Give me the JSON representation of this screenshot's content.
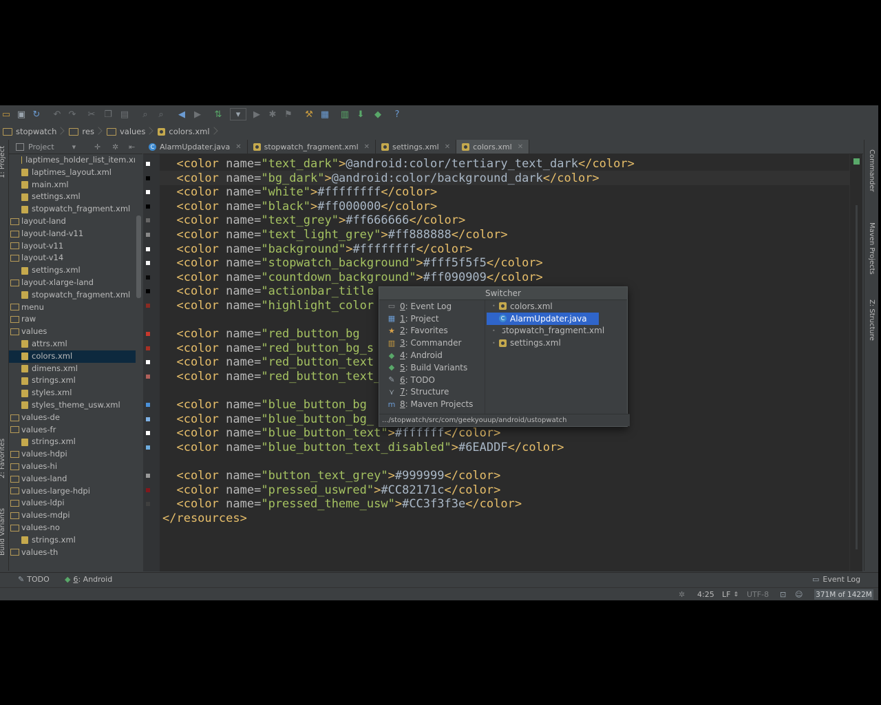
{
  "breadcrumb": [
    "stopwatch",
    "res",
    "values",
    "colors.xml"
  ],
  "project_panel": {
    "title": "Project",
    "tree": [
      {
        "label": "laptimes_holder_list_item.xı",
        "kind": "file",
        "indent": 2
      },
      {
        "label": "laptimes_layout.xml",
        "kind": "file",
        "indent": 2
      },
      {
        "label": "main.xml",
        "kind": "file",
        "indent": 2
      },
      {
        "label": "settings.xml",
        "kind": "file",
        "indent": 2
      },
      {
        "label": "stopwatch_fragment.xml",
        "kind": "file",
        "indent": 2
      },
      {
        "label": "layout-land",
        "kind": "folder",
        "indent": 1
      },
      {
        "label": "layout-land-v11",
        "kind": "folder",
        "indent": 1
      },
      {
        "label": "layout-v11",
        "kind": "folder",
        "indent": 1
      },
      {
        "label": "layout-v14",
        "kind": "folder",
        "indent": 1
      },
      {
        "label": "settings.xml",
        "kind": "file",
        "indent": 2
      },
      {
        "label": "layout-xlarge-land",
        "kind": "folder",
        "indent": 1
      },
      {
        "label": "stopwatch_fragment.xml",
        "kind": "file",
        "indent": 2
      },
      {
        "label": "menu",
        "kind": "folder",
        "indent": 1
      },
      {
        "label": "raw",
        "kind": "folder",
        "indent": 1
      },
      {
        "label": "values",
        "kind": "folder",
        "indent": 1
      },
      {
        "label": "attrs.xml",
        "kind": "file",
        "indent": 2
      },
      {
        "label": "colors.xml",
        "kind": "file",
        "indent": 2,
        "selected": true
      },
      {
        "label": "dimens.xml",
        "kind": "file",
        "indent": 2
      },
      {
        "label": "strings.xml",
        "kind": "file",
        "indent": 2
      },
      {
        "label": "styles.xml",
        "kind": "file",
        "indent": 2
      },
      {
        "label": "styles_theme_usw.xml",
        "kind": "file",
        "indent": 2
      },
      {
        "label": "values-de",
        "kind": "folder",
        "indent": 1
      },
      {
        "label": "values-fr",
        "kind": "folder",
        "indent": 1
      },
      {
        "label": "strings.xml",
        "kind": "file",
        "indent": 2
      },
      {
        "label": "values-hdpi",
        "kind": "folder",
        "indent": 1
      },
      {
        "label": "values-hi",
        "kind": "folder",
        "indent": 1
      },
      {
        "label": "values-land",
        "kind": "folder",
        "indent": 1
      },
      {
        "label": "values-large-hdpi",
        "kind": "folder",
        "indent": 1
      },
      {
        "label": "values-ldpi",
        "kind": "folder",
        "indent": 1
      },
      {
        "label": "values-mdpi",
        "kind": "folder",
        "indent": 1
      },
      {
        "label": "values-no",
        "kind": "folder",
        "indent": 1
      },
      {
        "label": "strings.xml",
        "kind": "file",
        "indent": 2
      },
      {
        "label": "values-th",
        "kind": "folder",
        "indent": 1
      }
    ]
  },
  "left_stripe": {
    "project": "1: Project",
    "favorites": "2: Favorites",
    "build_variants": "Build Variants"
  },
  "right_stripe": {
    "commander": "Commander",
    "maven": "Maven Projects",
    "structure": "Z: Structure"
  },
  "tabs": [
    {
      "label": "AlarmUpdater.java",
      "icon": "class-icon",
      "active": false
    },
    {
      "label": "stopwatch_fragment.xml",
      "icon": "xml-icon",
      "active": false
    },
    {
      "label": "settings.xml",
      "icon": "xml-icon",
      "active": false
    },
    {
      "label": "colors.xml",
      "icon": "xml-icon",
      "active": true
    }
  ],
  "code_lines": [
    {
      "name": "text_dark",
      "value": "@android:color/tertiary_text_dark",
      "swatch": "#ffffff"
    },
    {
      "name": "bg_dark",
      "value": "@android:color/background_dark",
      "swatch": "#000000"
    },
    {
      "name": "white",
      "value": "#ffffffff",
      "swatch": "#ffffff"
    },
    {
      "name": "black",
      "value": "#ff000000",
      "swatch": "#000000"
    },
    {
      "name": "text_grey",
      "value": "#ff666666",
      "swatch": "#666666"
    },
    {
      "name": "text_light_grey",
      "value": "#ff888888",
      "swatch": "#888888"
    },
    {
      "name": "background",
      "value": "#ffffffff",
      "swatch": "#ffffff"
    },
    {
      "name": "stopwatch_background",
      "value": "#fff5f5f5",
      "swatch": "#f5f5f5"
    },
    {
      "name": "countdown_background",
      "value": "#ff090909",
      "swatch": "#090909"
    },
    {
      "name": "actionbar_title",
      "value": "",
      "swatch": "#000000"
    },
    {
      "name": "highlight_color",
      "value": "",
      "swatch": "#8a2a22"
    },
    {
      "blank": true
    },
    {
      "name": "red_button_bg",
      "value": "",
      "swatch": "#c8382c"
    },
    {
      "name": "red_button_bg_s",
      "value": "",
      "swatch": "#a83024"
    },
    {
      "name": "red_button_text",
      "value": "",
      "swatch": "#ffffff"
    },
    {
      "name": "red_button_text_",
      "value": "",
      "swatch": "#b0605a"
    },
    {
      "blank": true
    },
    {
      "name": "blue_button_bg",
      "value": "",
      "swatch": "#4a90d9"
    },
    {
      "name": "blue_button_bg_",
      "value": "",
      "swatch": "#7fb2e5"
    },
    {
      "name": "blue_button_text",
      "value": "#ffffff",
      "swatch": "#ffffff"
    },
    {
      "name": "blue_button_text_disabled",
      "value": "#6EADDF",
      "swatch": "#6eaddf"
    },
    {
      "blank": true
    },
    {
      "name": "button_text_grey",
      "value": "#999999",
      "swatch": "#999999"
    },
    {
      "name": "pressed_uswred",
      "value": "#CC82171c",
      "swatch": "#82171c"
    },
    {
      "name": "pressed_theme_usw",
      "value": "#CC3f3f3e",
      "swatch": "#3f3f3e"
    },
    {
      "closing": "</resources>"
    }
  ],
  "switcher": {
    "title": "Switcher",
    "tool_windows": [
      {
        "key": "0",
        "label": ": Event Log",
        "icon": "event-log-icon"
      },
      {
        "key": "1",
        "label": ": Project",
        "icon": "project-icon"
      },
      {
        "key": "2",
        "label": ": Favorites",
        "icon": "star-icon"
      },
      {
        "key": "3",
        "label": ": Commander",
        "icon": "commander-icon"
      },
      {
        "key": "4",
        "label": ": Android",
        "icon": "android-icon"
      },
      {
        "key": "5",
        "label": ": Build Variants",
        "icon": "android-icon"
      },
      {
        "key": "6",
        "label": ": TODO",
        "icon": "todo-icon"
      },
      {
        "key": "7",
        "label": ": Structure",
        "icon": "structure-icon"
      },
      {
        "key": "8",
        "label": ": Maven Projects",
        "icon": "maven-icon"
      }
    ],
    "files": [
      {
        "label": "colors.xml",
        "selected": false
      },
      {
        "label": "AlarmUpdater.java",
        "selected": true
      },
      {
        "label": "stopwatch_fragment.xml",
        "selected": false
      },
      {
        "label": "settings.xml",
        "selected": false
      }
    ],
    "path": ".../stopwatch/src/com/geekyouup/android/ustopwatch"
  },
  "bottom_tools": {
    "todo": "TODO",
    "android_key": "6",
    "android": ": Android",
    "event_log": "Event Log"
  },
  "status": {
    "position": "4:25",
    "line_sep": "LF",
    "encoding": "UTF-8",
    "memory": "371M of 1422M"
  }
}
